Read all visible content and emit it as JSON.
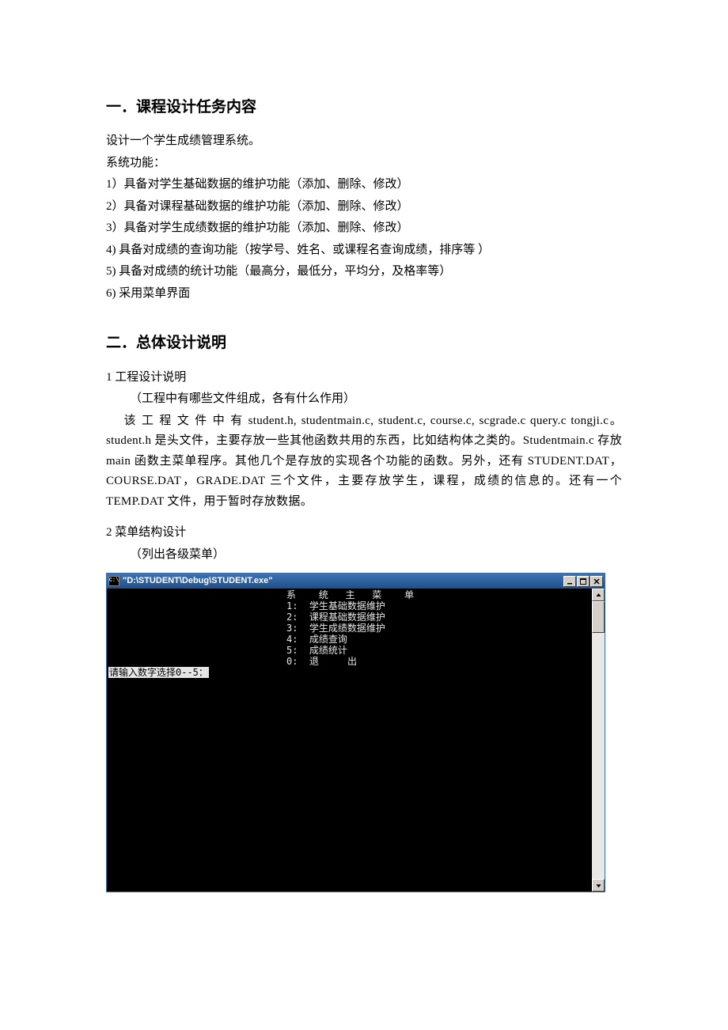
{
  "section1": {
    "heading": "一．课程设计任务内容",
    "p1": "设计一个学生成绩管理系统。",
    "p2": "系统功能：",
    "items": [
      "1）具备对学生基础数据的维护功能（添加、删除、修改）",
      "2）具备对课程基础数据的维护功能（添加、删除、修改）",
      "3）具备对学生成绩数据的维护功能（添加、删除、修改）",
      "4)   具备对成绩的查询功能（按学号、姓名、或课程名查询成绩，排序等  ）",
      "5)   具备对成绩的统计功能（最高分，最低分，平均分，及格率等）",
      "6)   采用菜单界面"
    ]
  },
  "section2": {
    "heading": "二．总体设计说明",
    "sub1_title": "1 工程设计说明",
    "sub1_note": "（工程中有哪些文件组成，各有什么作用）",
    "sub1_body": "该 工 程 文 件 中 有  student.h,     studentmain.c,     student.c,  course.c,     scgrade.c     query.c  tongji.c。student.h 是头文件，主要存放一些其他函数共用的东西，比如结构体之类的。Studentmain.c 存放 main 函数主菜单程序。其他几个是存放的实现各个功能的函数。另外，还有 STUDENT.DAT，COURSE.DAT，GRADE.DAT 三个文件，主要存放学生，课程，成绩的信息的。还有一个 TEMP.DAT 文件，用于暂时存放数据。",
    "sub2_title": "2 菜单结构设计",
    "sub2_note": "（列出各级菜单）"
  },
  "console": {
    "title": "\"D:\\STUDENT\\Debug\\STUDENT.exe\"",
    "icon_text": "C:\\",
    "menu_lines": [
      "系    统   主   菜    单",
      "1:  学生基础数据维护",
      "2:  课程基础数据维护",
      "3:  学生成绩数据维护",
      "4:  成绩查询",
      "5:  成绩统计",
      "0:  退     出"
    ],
    "prompt": "请输入数字选择0--5："
  }
}
